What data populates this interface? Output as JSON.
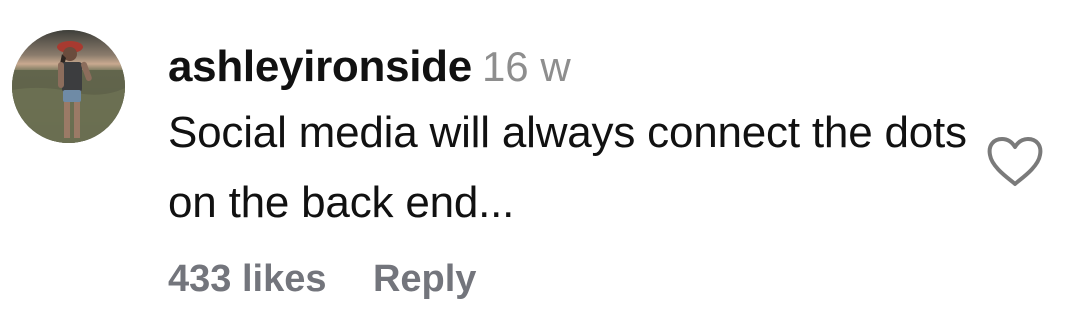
{
  "comment": {
    "username": "ashleyironside",
    "timestamp": "16 w",
    "text": "Social media will always connect the dots on the back end...",
    "likes_label": "433 likes",
    "reply_label": "Reply",
    "like_icon": "heart-outline-icon"
  },
  "colors": {
    "text": "#111111",
    "secondary": "#8e8e8e",
    "action": "#73757c"
  }
}
